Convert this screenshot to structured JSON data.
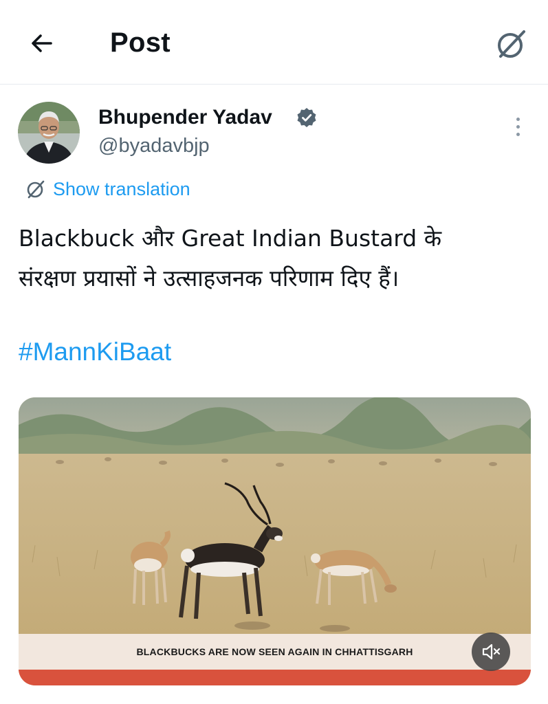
{
  "header": {
    "title": "Post",
    "back_icon": "arrow-left-icon",
    "grok_icon": "grok-icon"
  },
  "tweet": {
    "author": {
      "name": "Bhupender Yadav",
      "handle": "@byadavbjp",
      "verified": true,
      "verified_color": "#536471"
    },
    "translation_label": "Show translation",
    "text_lines": [
      "Blackbuck और Great Indian Bustard के",
      "संरक्षण प्रयासों ने उत्साहजनक परिणाम दिए हैं।"
    ],
    "hashtag": "#MannKiBaat",
    "media": {
      "caption": "BLACKBUCKS ARE NOW SEEN AGAIN IN CHHATTISGARH",
      "mute_icon": "volume-muted-icon",
      "muted": true
    }
  },
  "colors": {
    "link": "#1d9bf0",
    "secondary_text": "#536471",
    "caption_stripe": "#d9523d"
  }
}
